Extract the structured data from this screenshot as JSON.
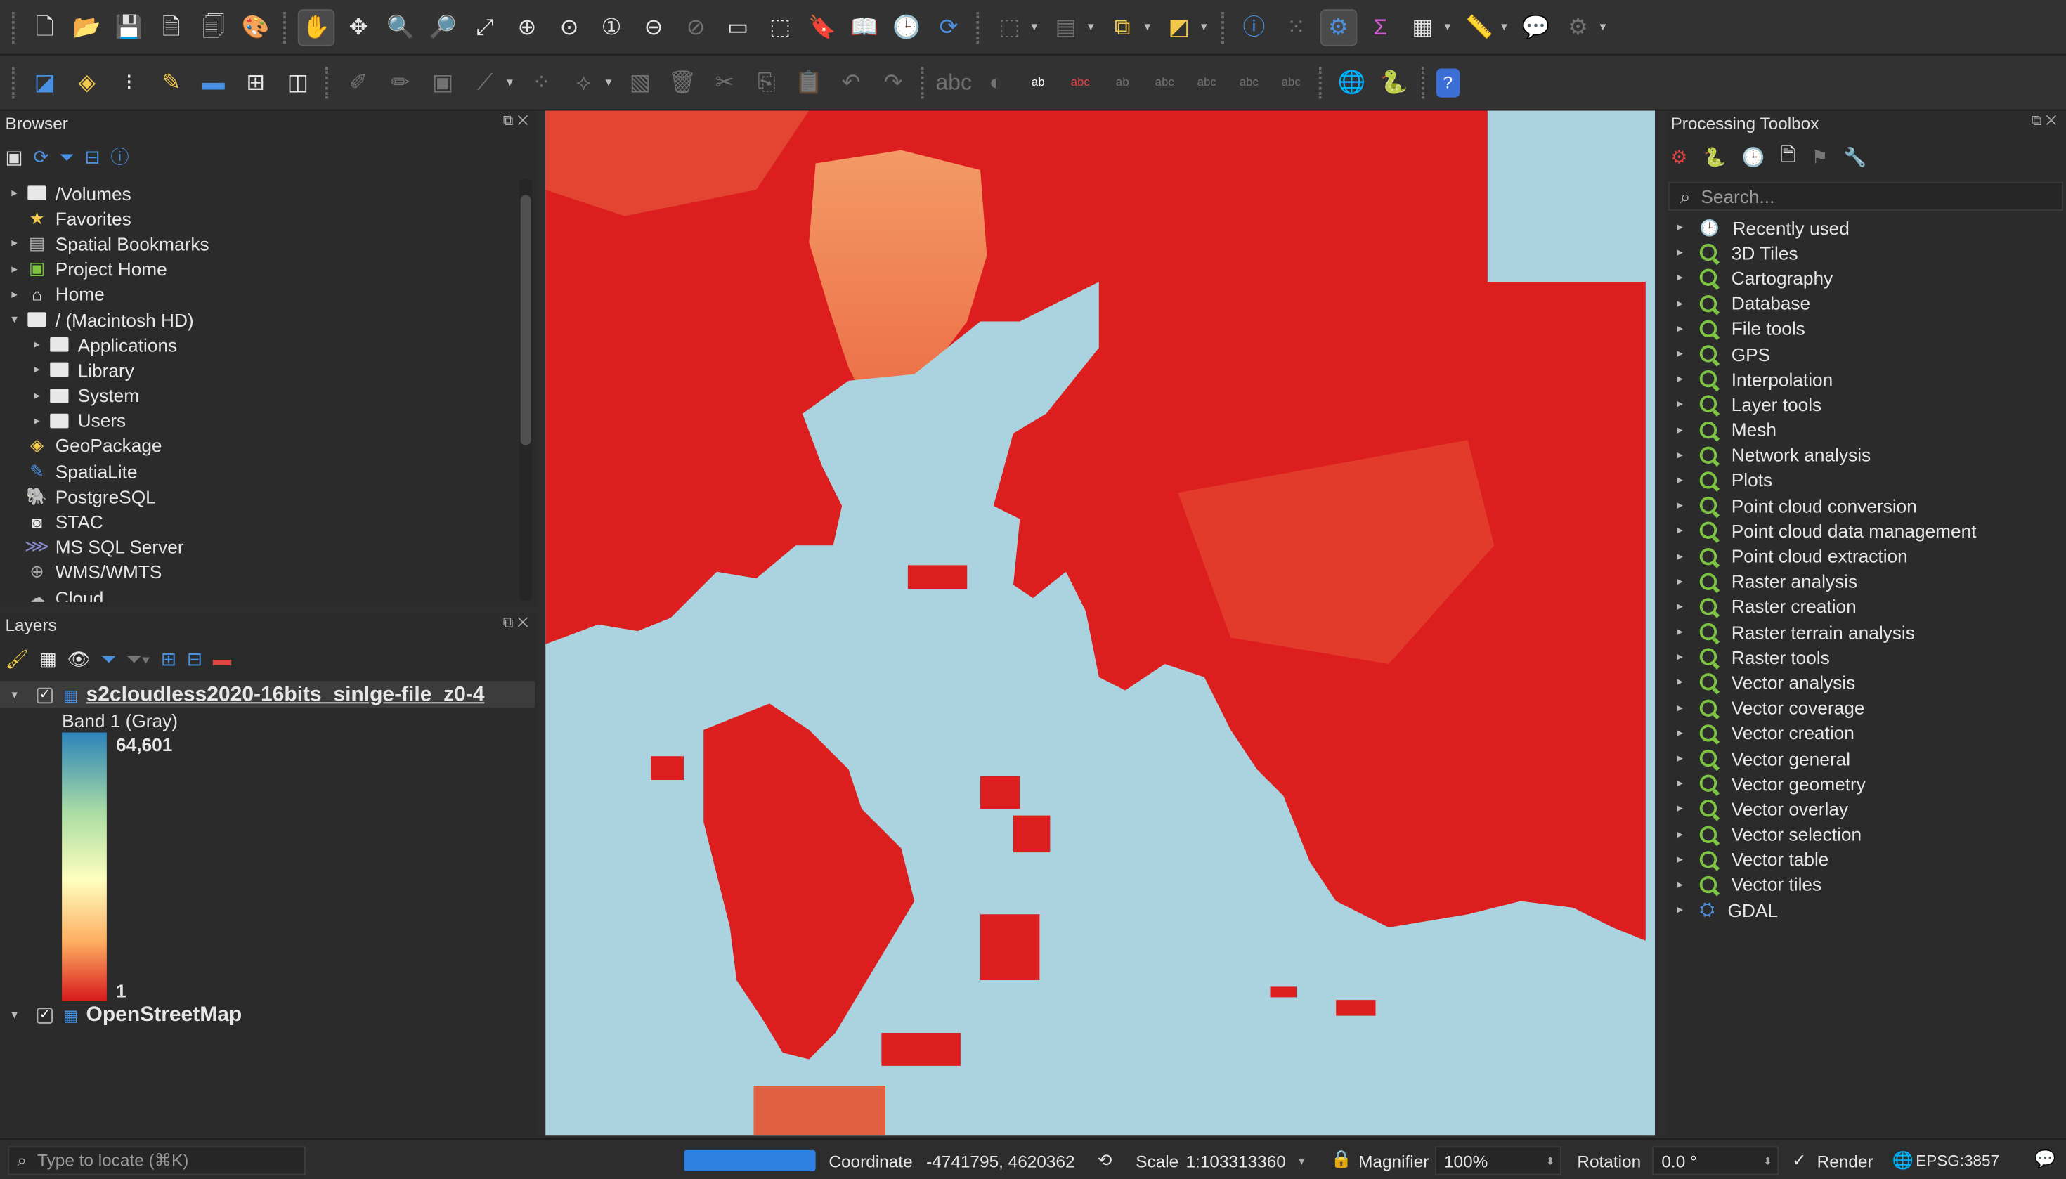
{
  "toolbar1": {
    "icons": [
      "new-project-icon",
      "open-project-icon",
      "save-project-icon",
      "new-print-layout-icon",
      "layout-manager-icon",
      "style-manager-icon",
      "pan-map-icon",
      "pan-to-selection-icon",
      "zoom-in-icon",
      "zoom-out-icon",
      "zoom-full-icon",
      "zoom-to-selection-icon",
      "zoom-to-layer-icon",
      "zoom-native-icon",
      "zoom-last-icon",
      "zoom-next-icon",
      "new-map-view-icon",
      "new-3d-map-view-icon",
      "new-spatial-bookmark-icon",
      "show-bookmarks-icon",
      "temporal-controller-icon",
      "refresh-icon",
      "select-features-icon",
      "attribute-table-icon",
      "deselect-icon",
      "select-location-icon",
      "identify-features-icon",
      "vertex-tool-icon",
      "processing-toolbox-icon",
      "statistical-summary-icon",
      "open-field-calculator-icon",
      "measure-line-icon",
      "map-tips-icon",
      "settings-icon"
    ]
  },
  "toolbar2": {
    "icons": [
      "add-vector-layer-icon",
      "new-geopackage-icon",
      "new-temporary-scratch-icon",
      "digitize-icon",
      "current-edits-icon",
      "toggle-editing-icon",
      "save-edits-icon",
      "add-feature-icon",
      "vertex-tool-icon",
      "delete-selected-icon",
      "cut-icon",
      "copy-icon",
      "paste-icon",
      "undo-icon",
      "redo-icon",
      "label-toolbar-icon",
      "layer-labeling-icon",
      "python-console-icon",
      "help-icon"
    ]
  },
  "browser": {
    "title": "Browser",
    "items": [
      {
        "label": "/Volumes",
        "icon": "folder-icon",
        "expander": "▸",
        "indent": 0
      },
      {
        "label": "Favorites",
        "icon": "star-icon",
        "expander": "",
        "indent": 0
      },
      {
        "label": "Spatial Bookmarks",
        "icon": "bookmark-icon",
        "expander": "▸",
        "indent": 0
      },
      {
        "label": "Project Home",
        "icon": "project-home-icon",
        "expander": "▸",
        "indent": 0
      },
      {
        "label": "Home",
        "icon": "home-icon",
        "expander": "▸",
        "indent": 0
      },
      {
        "label": "/ (Macintosh HD)",
        "icon": "folder-icon",
        "expander": "▾",
        "indent": 0
      },
      {
        "label": "Applications",
        "icon": "folder-icon",
        "expander": "▸",
        "indent": 1
      },
      {
        "label": "Library",
        "icon": "folder-icon",
        "expander": "▸",
        "indent": 1
      },
      {
        "label": "System",
        "icon": "folder-icon",
        "expander": "▸",
        "indent": 1
      },
      {
        "label": "Users",
        "icon": "folder-icon",
        "expander": "▸",
        "indent": 1
      },
      {
        "label": "GeoPackage",
        "icon": "geopackage-icon",
        "expander": "",
        "indent": 0
      },
      {
        "label": "SpatiaLite",
        "icon": "spatialite-icon",
        "expander": "",
        "indent": 0
      },
      {
        "label": "PostgreSQL",
        "icon": "postgresql-icon",
        "expander": "",
        "indent": 0
      },
      {
        "label": "STAC",
        "icon": "stac-icon",
        "expander": "",
        "indent": 0
      },
      {
        "label": "MS SQL Server",
        "icon": "mssql-icon",
        "expander": "",
        "indent": 0
      },
      {
        "label": "WMS/WMTS",
        "icon": "wms-icon",
        "expander": "",
        "indent": 0
      },
      {
        "label": "Cloud",
        "icon": "cloud-icon",
        "expander": "",
        "indent": 0
      }
    ]
  },
  "layers": {
    "title": "Layers",
    "layer1": {
      "name": "s2cloudless2020-16bits_sinlge-file_z0-4",
      "band": "Band 1 (Gray)",
      "max": "64,601",
      "min": "1"
    },
    "layer2": {
      "name": "OpenStreetMap"
    }
  },
  "toolbox": {
    "title": "Processing Toolbox",
    "search_placeholder": "Search...",
    "items": [
      {
        "label": "Recently used",
        "icon": "clock-icon"
      },
      {
        "label": "3D Tiles",
        "icon": "qgis-icon"
      },
      {
        "label": "Cartography",
        "icon": "qgis-icon"
      },
      {
        "label": "Database",
        "icon": "qgis-icon"
      },
      {
        "label": "File tools",
        "icon": "qgis-icon"
      },
      {
        "label": "GPS",
        "icon": "qgis-icon"
      },
      {
        "label": "Interpolation",
        "icon": "qgis-icon"
      },
      {
        "label": "Layer tools",
        "icon": "qgis-icon"
      },
      {
        "label": "Mesh",
        "icon": "qgis-icon"
      },
      {
        "label": "Network analysis",
        "icon": "qgis-icon"
      },
      {
        "label": "Plots",
        "icon": "qgis-icon"
      },
      {
        "label": "Point cloud conversion",
        "icon": "qgis-icon"
      },
      {
        "label": "Point cloud data management",
        "icon": "qgis-icon"
      },
      {
        "label": "Point cloud extraction",
        "icon": "qgis-icon"
      },
      {
        "label": "Raster analysis",
        "icon": "qgis-icon"
      },
      {
        "label": "Raster creation",
        "icon": "qgis-icon"
      },
      {
        "label": "Raster terrain analysis",
        "icon": "qgis-icon"
      },
      {
        "label": "Raster tools",
        "icon": "qgis-icon"
      },
      {
        "label": "Vector analysis",
        "icon": "qgis-icon"
      },
      {
        "label": "Vector coverage",
        "icon": "qgis-icon"
      },
      {
        "label": "Vector creation",
        "icon": "qgis-icon"
      },
      {
        "label": "Vector general",
        "icon": "qgis-icon"
      },
      {
        "label": "Vector geometry",
        "icon": "qgis-icon"
      },
      {
        "label": "Vector overlay",
        "icon": "qgis-icon"
      },
      {
        "label": "Vector selection",
        "icon": "qgis-icon"
      },
      {
        "label": "Vector table",
        "icon": "qgis-icon"
      },
      {
        "label": "Vector tiles",
        "icon": "qgis-icon"
      },
      {
        "label": "GDAL",
        "icon": "gdal-icon"
      }
    ]
  },
  "statusbar": {
    "locate_placeholder": "Type to locate (⌘K)",
    "coordinate_label": "Coordinate",
    "coordinate_value": "-4741795, 4620362",
    "scale_label": "Scale",
    "scale_value": "1:103313360",
    "magnifier_label": "Magnifier",
    "magnifier_value": "100%",
    "rotation_label": "Rotation",
    "rotation_value": "0.0 °",
    "render_label": "Render",
    "crs_label": "EPSG:3857"
  },
  "colors": {
    "raster_red": "#dc1e1e",
    "raster_light": "#f28c5a",
    "ocean": "#aad3df",
    "ramp_top": "#2b83ba",
    "ramp_bottom": "#d7191c",
    "accent_green": "#7cc442"
  }
}
